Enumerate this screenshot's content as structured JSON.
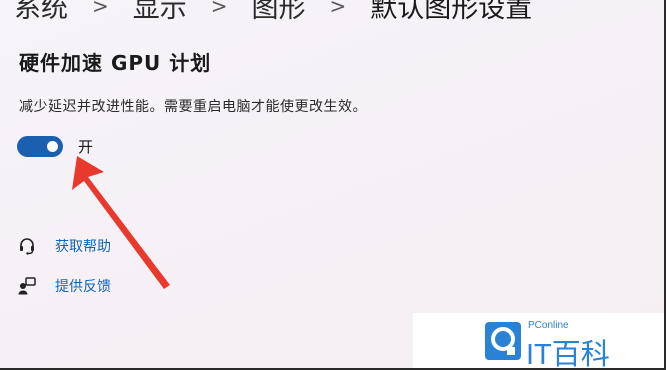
{
  "breadcrumb": {
    "items": [
      "系统",
      "显示",
      "图形"
    ],
    "current": "默认图形设置",
    "separator": ">"
  },
  "setting": {
    "title": "硬件加速 GPU 计划",
    "description": "减少延迟并改进性能。需要重启电脑才能使更改生效。",
    "toggle_on": true,
    "toggle_label": "开"
  },
  "links": {
    "help": "获取帮助",
    "feedback": "提供反馈"
  },
  "watermark": {
    "site": "PConline",
    "name": "IT百科"
  },
  "colors": {
    "accent": "#1a5fb0",
    "link": "#1464b4",
    "arrow": "#e8392c",
    "watermark": "#2a82d6"
  },
  "icons": {
    "help": "help-headset-icon",
    "feedback": "feedback-person-icon",
    "logo": "pconline-logo-icon"
  }
}
